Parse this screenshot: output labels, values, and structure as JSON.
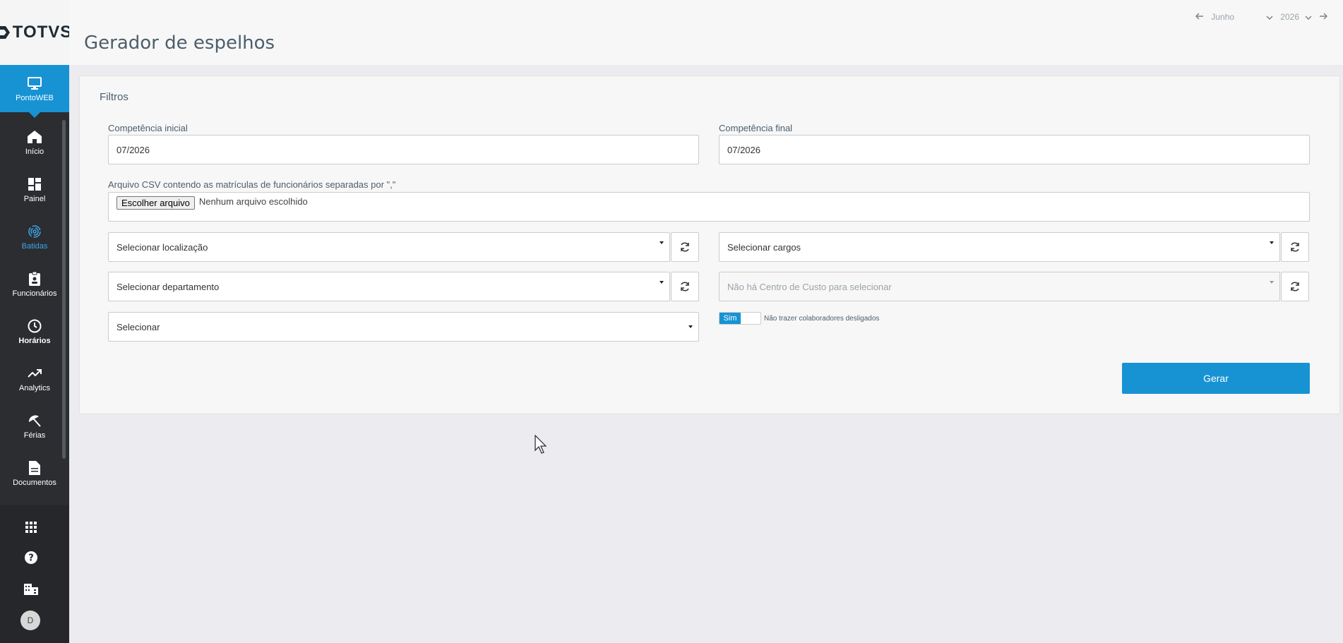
{
  "app": {
    "logo_text": "TOTVS"
  },
  "sidebar": {
    "top_item": {
      "label": "PontoWEB",
      "icon": "monitor-icon"
    },
    "items": [
      {
        "label": "Início",
        "icon": "home-icon"
      },
      {
        "label": "Painel",
        "icon": "dashboard-icon"
      },
      {
        "label": "Batidas",
        "icon": "fingerprint-icon"
      },
      {
        "label": "Funcionários",
        "icon": "badge-icon"
      },
      {
        "label": "Horários",
        "icon": "clock-icon"
      },
      {
        "label": "Analytics",
        "icon": "trending-up-icon"
      },
      {
        "label": "Férias",
        "icon": "beach-umbrella-icon"
      },
      {
        "label": "Documentos",
        "icon": "document-icon"
      }
    ],
    "bottom": {
      "avatar_initial": "D"
    }
  },
  "header": {
    "title": "Gerador de espelhos",
    "period": {
      "month": "Junho",
      "year": "2026"
    }
  },
  "filters": {
    "title": "Filtros",
    "competencia_inicial": {
      "label": "Competência inicial",
      "value": "07/2026"
    },
    "competencia_final": {
      "label": "Competência final",
      "value": "07/2026"
    },
    "arquivo": {
      "label": "Arquivo CSV contendo as matrículas de funcionários separadas por \",\"",
      "button": "Escolher arquivo",
      "status": "Nenhum arquivo escolhido"
    },
    "localizacao": {
      "value": "Selecionar localização"
    },
    "cargos": {
      "value": "Selecionar cargos"
    },
    "departamento": {
      "value": "Selecionar departamento"
    },
    "centro_custo": {
      "value": "Não há Centro de Custo para selecionar"
    },
    "selecionar": {
      "value": "Selecionar"
    },
    "toggle": {
      "on_label": "Sim",
      "label": "Não trazer colaboradores desligados"
    },
    "submit": "Gerar"
  }
}
